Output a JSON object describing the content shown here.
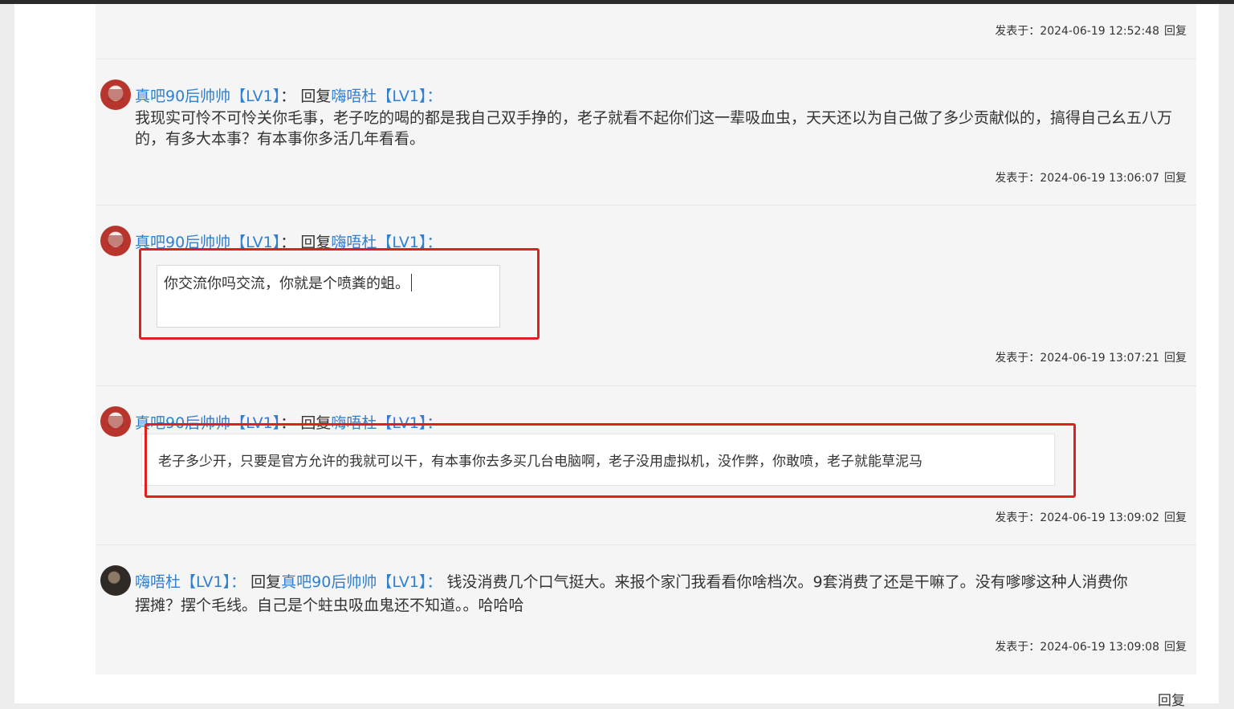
{
  "posts": [
    {
      "meta_prefix": "发表于：",
      "time": "2024-06-19 12:52:48",
      "reply_label": "回复"
    },
    {
      "author": "真吧90后帅帅【LV1】",
      "colon": "：",
      "reply_word": "回复",
      "target": "嗨唔杜【LV1】",
      "text": "我现实可怜不可怜关你毛事，老子吃的喝的都是我自己双手挣的，老子就看不起你们这一辈吸血虫，天天还以为自己做了多少贡献似的，搞得自己幺五八万的，有多大本事？有本事你多活几年看看。",
      "meta_prefix": "发表于：",
      "time": "2024-06-19 13:06:07",
      "reply_label": "回复"
    },
    {
      "author": "真吧90后帅帅【LV1】",
      "colon": "：",
      "reply_word": "回复",
      "target": "嗨唔杜【LV1】",
      "text": "你交流你吗交流，你就是个喷粪的蛆。",
      "meta_prefix": "发表于：",
      "time": "2024-06-19 13:07:21",
      "reply_label": "回复"
    },
    {
      "author": "真吧90后帅帅【LV1】",
      "colon": "：",
      "reply_word": "回复",
      "target": "嗨唔杜【LV1】",
      "text": "老子多少开，只要是官方允许的我就可以干，有本事你去多买几台电脑啊，老子没用虚拟机，没作弊，你敢喷，老子就能草泥马",
      "meta_prefix": "发表于：",
      "time": "2024-06-19 13:09:02",
      "reply_label": "回复"
    },
    {
      "author": "嗨唔杜【LV1】",
      "colon": "：",
      "reply_word": "回复",
      "target": "真吧90后帅帅【LV1】",
      "text_line1": "钱没消费几个口气挺大。来报个家门我看看你啥档次。9套消费了还是干嘛了。没有嗲嗲这种人消费你",
      "text_line2": "摆摊？摆个毛线。自己是个蛀虫吸血鬼还不知道。。哈哈哈",
      "meta_prefix": "发表于：",
      "time": "2024-06-19 13:09:08",
      "reply_label": "回复"
    }
  ],
  "bottom_reply_label": "回复",
  "colors": {
    "link": "#2f80d0",
    "highlight": "#e02020",
    "thread_bg": "#f5f5f5"
  },
  "icons": [
    "avatar-red-seal",
    "avatar-dark-photo"
  ]
}
